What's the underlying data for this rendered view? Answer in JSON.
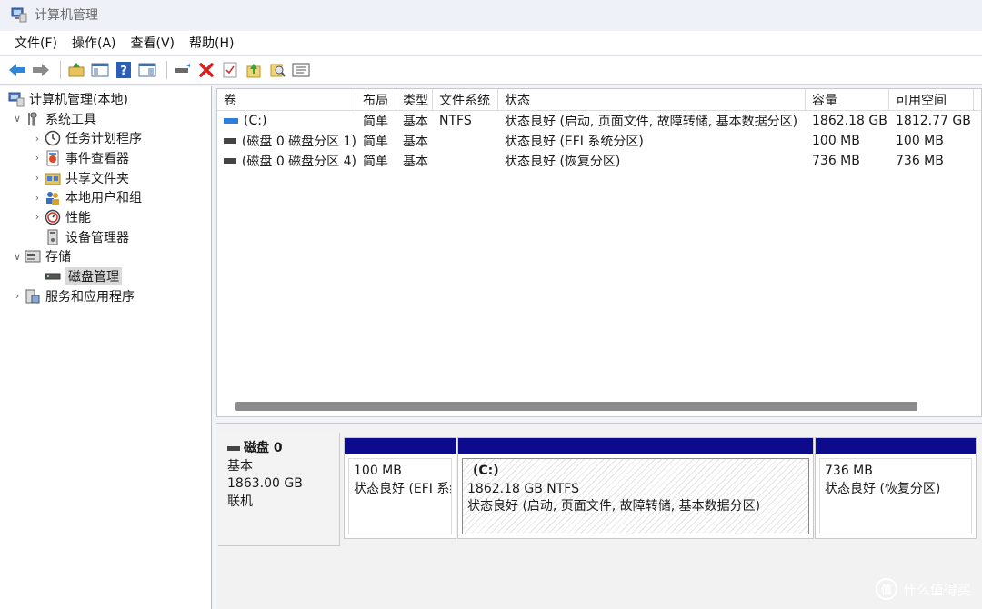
{
  "window": {
    "title": "计算机管理"
  },
  "menu": [
    "文件(F)",
    "操作(A)",
    "查看(V)",
    "帮助(H)"
  ],
  "toolbar": {
    "icons": [
      "back-arrow-icon",
      "forward-arrow-icon",
      "up-folder-icon",
      "show-hide-tree-icon",
      "help-icon",
      "properties-icon",
      "connect-icon",
      "delete-icon",
      "check-icon",
      "upload-icon",
      "search-icon",
      "list-icon"
    ]
  },
  "tree": {
    "root": "计算机管理(本地)",
    "system_tools": "系统工具",
    "task_scheduler": "任务计划程序",
    "event_viewer": "事件查看器",
    "shared_folders": "共享文件夹",
    "local_users": "本地用户和组",
    "performance": "性能",
    "device_manager": "设备管理器",
    "storage": "存储",
    "disk_management": "磁盘管理",
    "services_apps": "服务和应用程序"
  },
  "volumes": {
    "headers": [
      "卷",
      "布局",
      "类型",
      "文件系统",
      "状态",
      "容量",
      "可用空间"
    ],
    "rows": [
      {
        "vol": "(C:)",
        "layout": "简单",
        "type": "基本",
        "fs": "NTFS",
        "status": "状态良好 (启动, 页面文件, 故障转储, 基本数据分区)",
        "capacity": "1862.18 GB",
        "free": "1812.77 GB"
      },
      {
        "vol": "(磁盘 0 磁盘分区 1)",
        "layout": "简单",
        "type": "基本",
        "fs": "",
        "status": "状态良好 (EFI 系统分区)",
        "capacity": "100 MB",
        "free": "100 MB"
      },
      {
        "vol": "(磁盘 0 磁盘分区 4)",
        "layout": "简单",
        "type": "基本",
        "fs": "",
        "status": "状态良好 (恢复分区)",
        "capacity": "736 MB",
        "free": "736 MB"
      }
    ]
  },
  "disk": {
    "name": "磁盘 0",
    "kind": "基本",
    "size": "1863.00 GB",
    "state": "联机",
    "partitions": [
      {
        "name": "",
        "size": "100 MB",
        "status": "状态良好 (EFI 系统分区)"
      },
      {
        "name": "(C:)",
        "size": "1862.18 GB NTFS",
        "status": "状态良好 (启动, 页面文件, 故障转储, 基本数据分区)"
      },
      {
        "name": "",
        "size": "736 MB",
        "status": "状态良好 (恢复分区)"
      }
    ]
  },
  "watermark": {
    "text": "什么值得买",
    "logo": "值"
  },
  "colors": {
    "partition_bar": "#0b0b8c",
    "selected_bg": "#d9d9d9"
  }
}
